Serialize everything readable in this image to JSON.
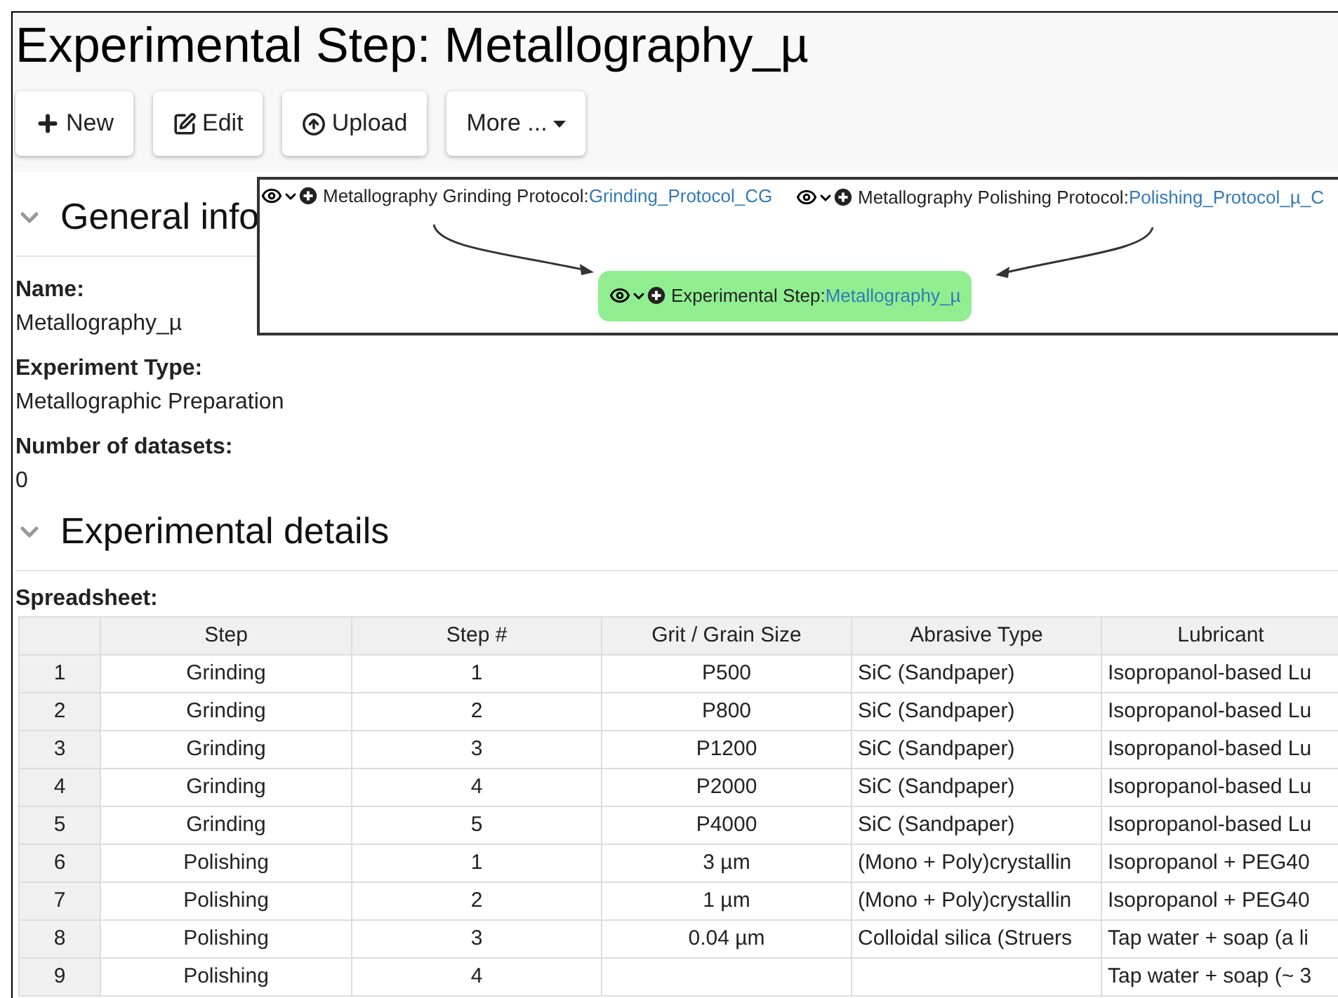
{
  "title": "Experimental Step: Metallography_µ",
  "toolbar": [
    {
      "kind": "new",
      "label": "New"
    },
    {
      "kind": "edit",
      "label": "Edit"
    },
    {
      "kind": "upload",
      "label": "Upload"
    },
    {
      "kind": "more",
      "label": "More ..."
    }
  ],
  "graph": {
    "nodes": [
      {
        "type_label": "Metallography Grinding Protocol:",
        "link": "Grinding_Protocol_CG",
        "selected": false
      },
      {
        "type_label": "Metallography Polishing Protocol:",
        "link": "Polishing_Protocol_µ_C",
        "selected": false
      },
      {
        "type_label": "Experimental Step:",
        "link": "Metallography_µ",
        "selected": true
      }
    ]
  },
  "general_info": {
    "heading": "General info",
    "expanded": true,
    "fields": [
      {
        "label": "Name:",
        "value": "Metallography_µ"
      },
      {
        "label": "Experiment Type:",
        "value": "Metallographic Preparation"
      },
      {
        "label": "Number of datasets:",
        "value": "0"
      }
    ]
  },
  "experimental_details": {
    "heading": "Experimental details",
    "expanded": true,
    "spreadsheet_label": "Spreadsheet:",
    "table": {
      "columns": [
        "",
        "Step",
        "Step #",
        "Grit / Grain Size",
        "Abrasive Type",
        "Lubricant"
      ],
      "rows": [
        [
          "1",
          "Grinding",
          "1",
          "P500",
          "SiC (Sandpaper)",
          "Isopropanol-based Lu"
        ],
        [
          "2",
          "Grinding",
          "2",
          "P800",
          "SiC (Sandpaper)",
          "Isopropanol-based Lu"
        ],
        [
          "3",
          "Grinding",
          "3",
          "P1200",
          "SiC (Sandpaper)",
          "Isopropanol-based Lu"
        ],
        [
          "4",
          "Grinding",
          "4",
          "P2000",
          "SiC (Sandpaper)",
          "Isopropanol-based Lu"
        ],
        [
          "5",
          "Grinding",
          "5",
          "P4000",
          "SiC (Sandpaper)",
          "Isopropanol-based Lu"
        ],
        [
          "6",
          "Polishing",
          "1",
          "3 µm",
          "(Mono + Poly)crystallin",
          "Isopropanol + PEG40"
        ],
        [
          "7",
          "Polishing",
          "2",
          "1 µm",
          "(Mono + Poly)crystallin",
          "Isopropanol + PEG40"
        ],
        [
          "8",
          "Polishing",
          "3",
          "0.04 µm",
          "Colloidal silica (Struers",
          "Tap water + soap (a li"
        ],
        [
          "9",
          "Polishing",
          "4",
          "",
          "",
          "Tap water + soap (~ 3"
        ]
      ]
    }
  }
}
